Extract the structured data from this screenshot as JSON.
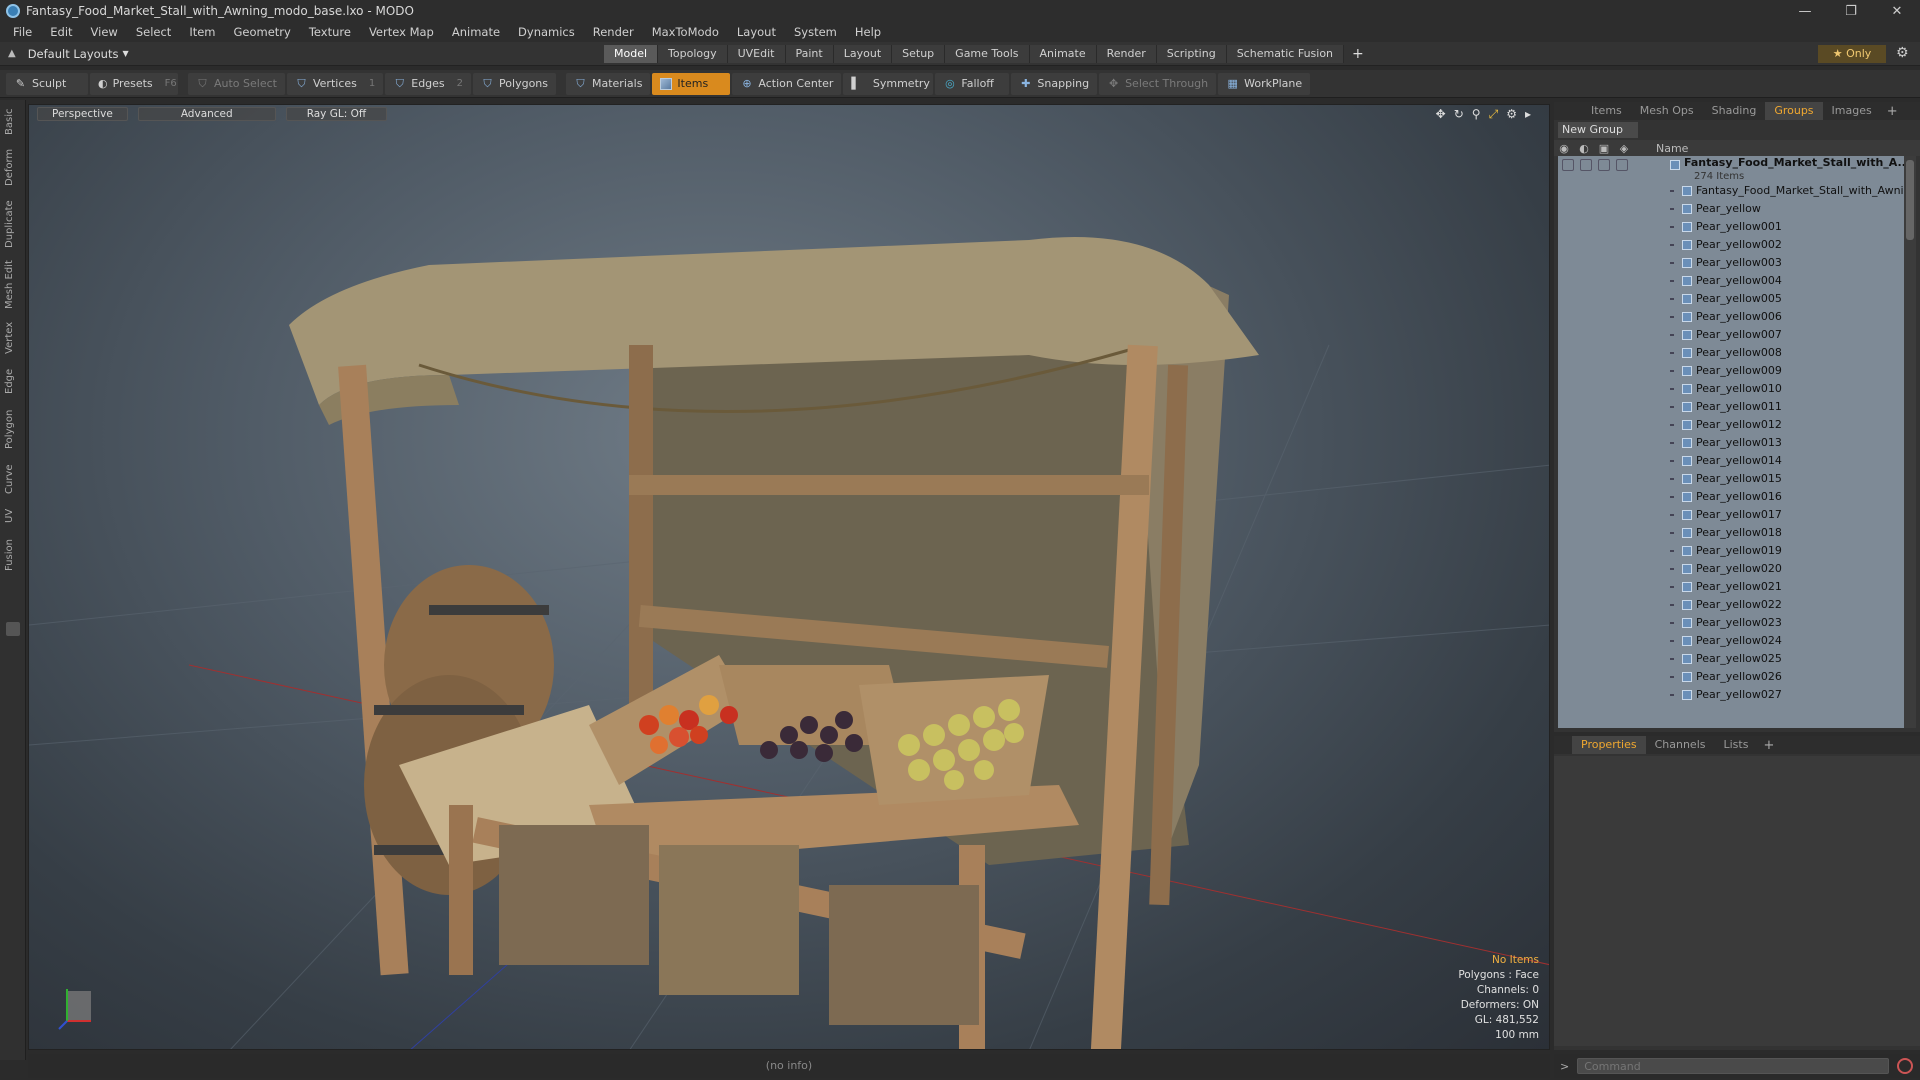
{
  "window": {
    "title": "Fantasy_Food_Market_Stall_with_Awning_modo_base.lxo - MODO",
    "controls": [
      "—",
      "❐",
      "✕"
    ]
  },
  "menu": [
    "File",
    "Edit",
    "View",
    "Select",
    "Item",
    "Geometry",
    "Texture",
    "Vertex Map",
    "Animate",
    "Dynamics",
    "Render",
    "MaxToModo",
    "Layout",
    "System",
    "Help"
  ],
  "modebar": {
    "layout": "Default Layouts",
    "tabs": [
      "Model",
      "Topology",
      "UVEdit",
      "Paint",
      "Layout",
      "Setup",
      "Game Tools",
      "Animate",
      "Render",
      "Scripting",
      "Schematic Fusion"
    ],
    "active_tab": "Model",
    "only_label": "★  Only"
  },
  "toolbar": {
    "sculpt": "Sculpt",
    "presets": "Presets",
    "presets_key": "F6",
    "auto_select": "Auto Select",
    "vertices": "Vertices",
    "vertices_key": "1",
    "edges": "Edges",
    "edges_key": "2",
    "polygons": "Polygons",
    "materials": "Materials",
    "items": "Items",
    "action_center": "Action Center",
    "symmetry": "Symmetry",
    "falloff": "Falloff",
    "snapping": "Snapping",
    "select_through": "Select Through",
    "workplane": "WorkPlane"
  },
  "left_tabs": [
    "Basic",
    "Deform",
    "Duplicate",
    "Mesh Edit",
    "Vertex",
    "Edge",
    "Polygon",
    "Curve",
    "UV",
    "Fusion"
  ],
  "viewport": {
    "view": "Perspective",
    "shading": "Advanced",
    "raygl": "Ray GL: Off",
    "info": {
      "no_items": "No Items",
      "polygons": "Polygons : Face",
      "channels": "Channels: 0",
      "deformers": "Deformers: ON",
      "gl": "GL: 481,552",
      "scale": "100 mm"
    }
  },
  "status": "(no info)",
  "right_panel": {
    "tabs": [
      "Items",
      "Mesh Ops",
      "Shading",
      "Groups",
      "Images"
    ],
    "active_tab": "Groups",
    "new_group": "New Group",
    "name_header": "Name",
    "group_name": "Fantasy_Food_Market_Stall_with_A...",
    "group_count": "274 Items",
    "items": [
      "Fantasy_Food_Market_Stall_with_Awning",
      "Pear_yellow",
      "Pear_yellow001",
      "Pear_yellow002",
      "Pear_yellow003",
      "Pear_yellow004",
      "Pear_yellow005",
      "Pear_yellow006",
      "Pear_yellow007",
      "Pear_yellow008",
      "Pear_yellow009",
      "Pear_yellow010",
      "Pear_yellow011",
      "Pear_yellow012",
      "Pear_yellow013",
      "Pear_yellow014",
      "Pear_yellow015",
      "Pear_yellow016",
      "Pear_yellow017",
      "Pear_yellow018",
      "Pear_yellow019",
      "Pear_yellow020",
      "Pear_yellow021",
      "Pear_yellow022",
      "Pear_yellow023",
      "Pear_yellow024",
      "Pear_yellow025",
      "Pear_yellow026",
      "Pear_yellow027"
    ]
  },
  "props_panel": {
    "tabs": [
      "Properties",
      "Channels",
      "Lists"
    ],
    "active_tab": "Properties"
  },
  "command": {
    "prompt": ">",
    "placeholder": "Command"
  },
  "colors": {
    "accent": "#f0a830",
    "active_tool": "#d98a1e"
  }
}
